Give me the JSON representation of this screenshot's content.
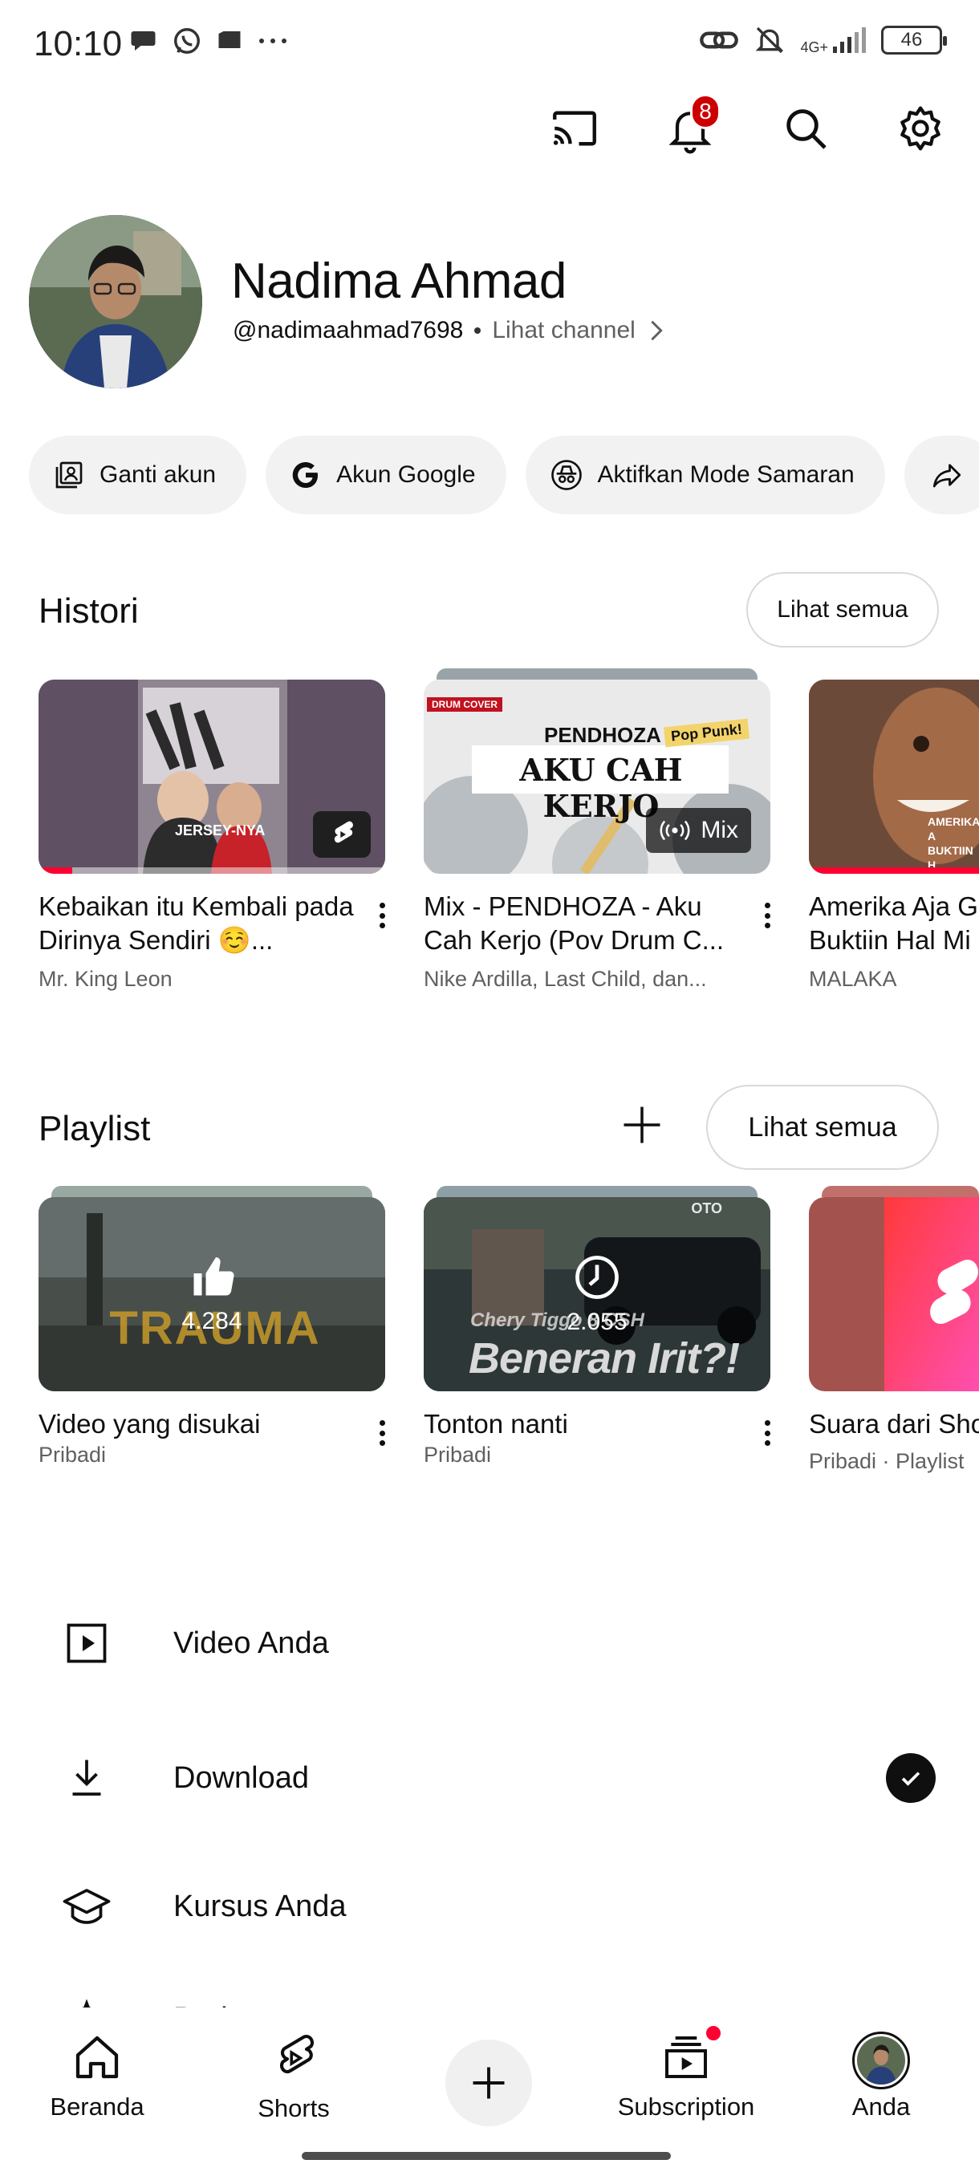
{
  "status_bar": {
    "time": "10:10",
    "network": "4G+",
    "battery": "46"
  },
  "top_bar": {
    "notification_count": "8"
  },
  "profile": {
    "name": "Nadima Ahmad",
    "handle": "@nadimaahmad7698",
    "view_channel": "Lihat channel"
  },
  "chips": [
    {
      "label": "Ganti akun",
      "icon": "switch-account-icon"
    },
    {
      "label": "Akun Google",
      "icon": "google-icon"
    },
    {
      "label": "Aktifkan Mode Samaran",
      "icon": "incognito-icon"
    }
  ],
  "history": {
    "title": "Histori",
    "see_all": "Lihat semua",
    "items": [
      {
        "title": "Kebaikan itu Kembali pada Dirinya Sendiri ☺️...",
        "channel": "Mr. King Leon",
        "thumb_caption": "JERSEY-NYA",
        "progress": 0.08
      },
      {
        "title": "Mix - PENDHOZA - Aku Cah Kerjo (Pov Drum C...",
        "channel": "Nike Ardilla, Last Child, dan...",
        "thumb_caption": "AKU CAH KERJO",
        "thumb_tag": "PENDHOZA",
        "thumb_badge": "Mix",
        "thumb_corner": "DRUM COVER",
        "thumb_sticker": "Pop Punk!"
      },
      {
        "title": "Amerika Aja G Buktiin Hal Mi",
        "channel": "MALAKA",
        "thumb_caption": "AMERIKA A BUKTIIN H",
        "progress": 1.0
      }
    ]
  },
  "playlist": {
    "title": "Playlist",
    "see_all": "Lihat semua",
    "items": [
      {
        "title": "Video yang disukai",
        "sub": "Pribadi",
        "count": "4.284",
        "icon": "thumbs-up-icon",
        "thumb_caption": "TRAUMA"
      },
      {
        "title": "Tonton nanti",
        "sub": "Pribadi",
        "count": "2.055",
        "icon": "clock-icon",
        "thumb_caption": "Beneran Irit?!",
        "thumb_small": "Chery Tiggo 8 CSH",
        "thumb_logo": "OTO"
      },
      {
        "title": "Suara dari Sho",
        "sub": "Pribadi · Playlist",
        "icon": "shorts-icon"
      }
    ]
  },
  "menu": [
    {
      "label": "Video Anda",
      "icon": "play-box-icon"
    },
    {
      "label": "Download",
      "icon": "download-icon",
      "status": "downloaded-check-icon"
    },
    {
      "label": "Kursus Anda",
      "icon": "graduation-cap-icon"
    },
    {
      "label": "Badge",
      "icon": "sparkle-icon"
    }
  ],
  "bottom_nav": [
    {
      "label": "Beranda",
      "icon": "home-icon"
    },
    {
      "label": "Shorts",
      "icon": "shorts-icon"
    },
    {
      "label": "Subscription",
      "icon": "subscriptions-icon"
    },
    {
      "label": "Anda",
      "icon": "avatar"
    }
  ],
  "colors": {
    "brand_red": "#ff0033",
    "badge_red": "#cc0000",
    "chip_bg": "#f2f2f2",
    "text_primary": "#0f0f0f",
    "text_secondary": "#606060"
  }
}
